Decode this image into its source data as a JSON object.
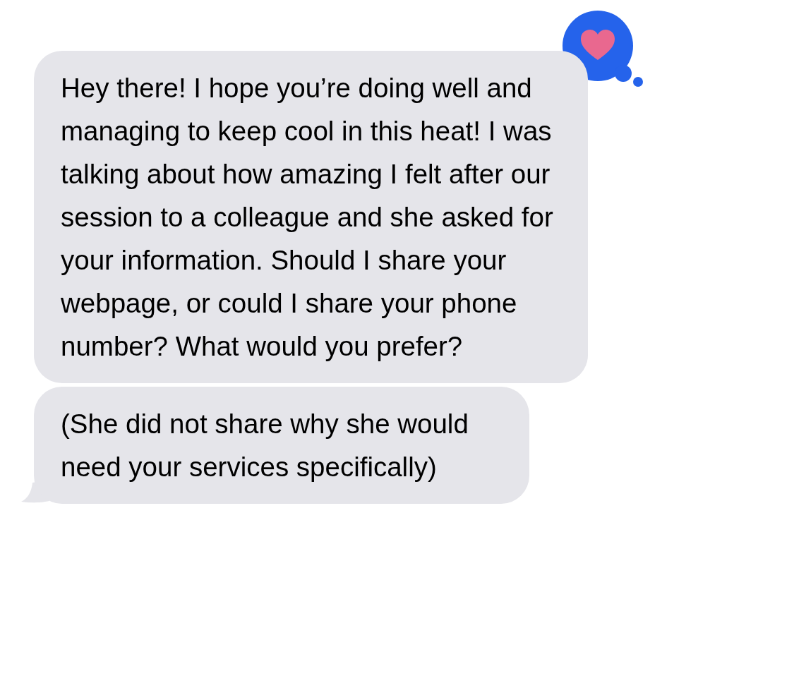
{
  "messages": [
    {
      "text": "Hey there! I hope you’re doing well and managing to keep cool in this heat! I was talking about how amazing I felt after our session to a colleague and she asked for your information. Should I share your webpage, or could I share your phone number? What would you prefer?",
      "tail": false,
      "reaction": {
        "kind": "heart"
      }
    },
    {
      "text": "(She did not share why she would need your services specifically)",
      "tail": true
    }
  ]
}
